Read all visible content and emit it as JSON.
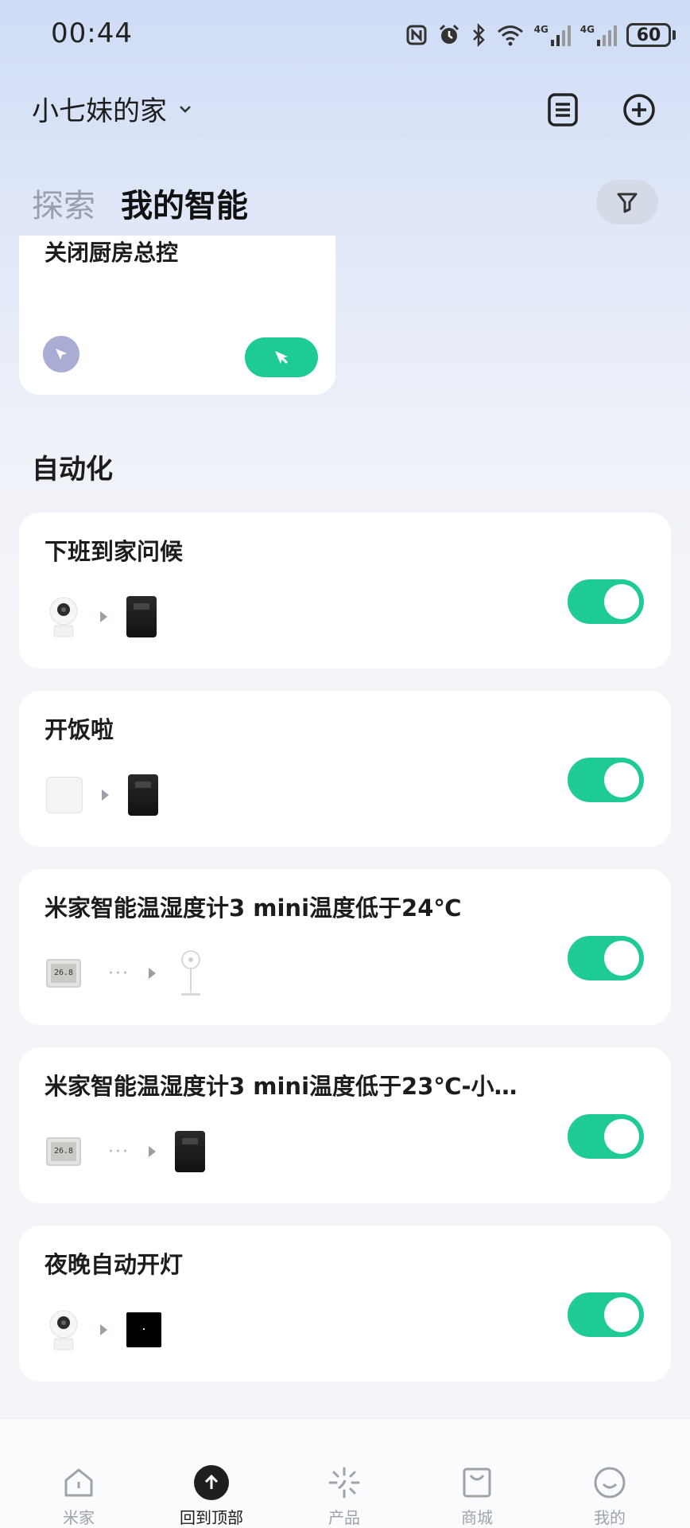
{
  "status_bar": {
    "time": "00:44",
    "network_1": "4G",
    "network_2": "4G",
    "battery_level": "60"
  },
  "header": {
    "home_name": "小七妹的家"
  },
  "tabs": [
    {
      "label": "探索",
      "active": false
    },
    {
      "label": "我的智能",
      "active": true
    }
  ],
  "scene_card": {
    "name": "关闭厨房总控"
  },
  "section_title": "自动化",
  "automations": [
    {
      "name": "下班到家问候",
      "enabled": true,
      "devices": [
        "camera-icon",
        "speaker-icon"
      ]
    },
    {
      "name": "开饭啦",
      "enabled": true,
      "devices": [
        "white-cube-device-icon",
        "speaker-icon"
      ]
    },
    {
      "name": "米家智能温湿度计3 mini温度低于24℃",
      "enabled": true,
      "devices": [
        "thermometer-icon",
        "fan-icon"
      ]
    },
    {
      "name": "米家智能温湿度计3 mini温度低于23℃-小…",
      "enabled": true,
      "devices": [
        "thermometer-icon",
        "speaker-icon"
      ]
    },
    {
      "name": "夜晚自动开灯",
      "enabled": true,
      "devices": [
        "camera-icon",
        "wall-switch-icon"
      ]
    }
  ],
  "thermo_readout": "26.8",
  "bottom_nav": [
    {
      "label": "米家",
      "icon": "home-icon",
      "active": false
    },
    {
      "label": "回到顶部",
      "icon": "arrow-up-icon",
      "active": true
    },
    {
      "label": "产品",
      "icon": "sparkle-icon",
      "active": false
    },
    {
      "label": "商城",
      "icon": "shopping-bag-icon",
      "active": false
    },
    {
      "label": "我的",
      "icon": "smiley-icon",
      "active": false
    }
  ],
  "colors": {
    "accent_green": "#1ecb96",
    "scene_icon_purple": "#a9acd3"
  }
}
